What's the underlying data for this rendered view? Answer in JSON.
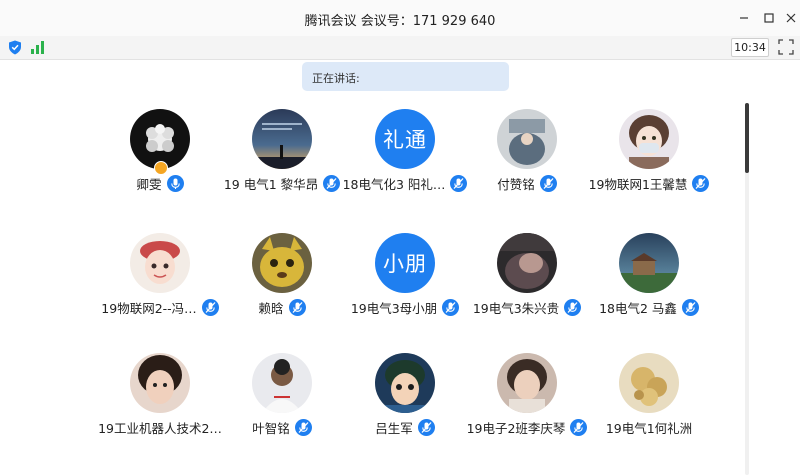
{
  "window": {
    "title": "腾讯会议 会议号：171 929 640",
    "minimize_icon": "minimize-icon",
    "maximize_icon": "maximize-icon",
    "close_icon": "close-icon"
  },
  "toolbar": {
    "shield_icon": "shield-icon",
    "signal_icon": "signal-icon",
    "clock": "10:34",
    "fullscreen_icon": "fullscreen-icon"
  },
  "speaking": {
    "label": "正在讲话:"
  },
  "colors": {
    "accent": "#1f7ff0",
    "speaking_bg": "#dde9f8",
    "signal": "#2bb24c",
    "host_badge": "#f5a623"
  },
  "participants": [
    {
      "name": "卿雯",
      "avatar_text": "",
      "mic": "unmuted",
      "host": true
    },
    {
      "name": "19 电气1   黎华昂",
      "avatar_text": "",
      "mic": "muted"
    },
    {
      "name": "18电气化3 阳礼…",
      "avatar_text": "礼通",
      "mic": "muted"
    },
    {
      "name": "付赞铭",
      "avatar_text": "",
      "mic": "muted"
    },
    {
      "name": "19物联网1王馨慧",
      "avatar_text": "",
      "mic": "muted"
    },
    {
      "name": "19物联网2--冯…",
      "avatar_text": "",
      "mic": "muted"
    },
    {
      "name": "赖晗",
      "avatar_text": "",
      "mic": "muted"
    },
    {
      "name": "19电气3母小朋",
      "avatar_text": "小朋",
      "mic": "muted"
    },
    {
      "name": "19电气3朱兴贵",
      "avatar_text": "",
      "mic": "muted"
    },
    {
      "name": "18电气2 马鑫",
      "avatar_text": "",
      "mic": "muted"
    },
    {
      "name": "19工业机器人技术2…",
      "avatar_text": "",
      "mic": "none"
    },
    {
      "name": "叶智铭",
      "avatar_text": "",
      "mic": "muted"
    },
    {
      "name": "吕生军",
      "avatar_text": "",
      "mic": "muted"
    },
    {
      "name": "19电子2班李庆琴",
      "avatar_text": "",
      "mic": "muted"
    },
    {
      "name": "19电气1何礼洲",
      "avatar_text": "",
      "mic": "none"
    }
  ]
}
